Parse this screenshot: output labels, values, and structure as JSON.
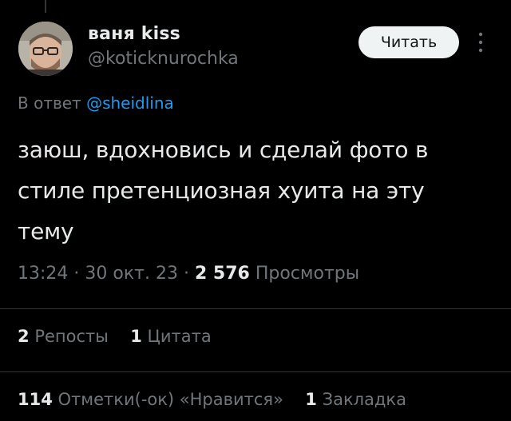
{
  "author": {
    "display_name": "ваня kiss",
    "handle": "@koticknurochka"
  },
  "follow_label": "Читать",
  "reply": {
    "prefix": "В ответ",
    "mention": "@sheidlina"
  },
  "tweet": {
    "text": "заюш, вдохновись и сделай фото в стиле претенциозная хуита на эту тему"
  },
  "meta": {
    "time": "13:24",
    "separator": "·",
    "date": "30 окт. 23",
    "views_count": "2 576",
    "views_label": "Просмотры"
  },
  "stats_row_1": {
    "reposts_count": "2",
    "reposts_label": "Репосты",
    "quotes_count": "1",
    "quotes_label": "Цитата"
  },
  "stats_row_2": {
    "likes_count": "114",
    "likes_label": "Отметки(-ок) «Нравится»",
    "bookmarks_count": "1",
    "bookmarks_label": "Закладка"
  },
  "colors": {
    "background": "#000000",
    "text_primary": "#e7e9ea",
    "text_secondary": "#71767b",
    "link": "#1d9bf0",
    "divider": "#2f3336",
    "button_bg": "#eff3f4"
  },
  "icons": {
    "more": "more-vertical-icon",
    "avatar": "avatar"
  }
}
